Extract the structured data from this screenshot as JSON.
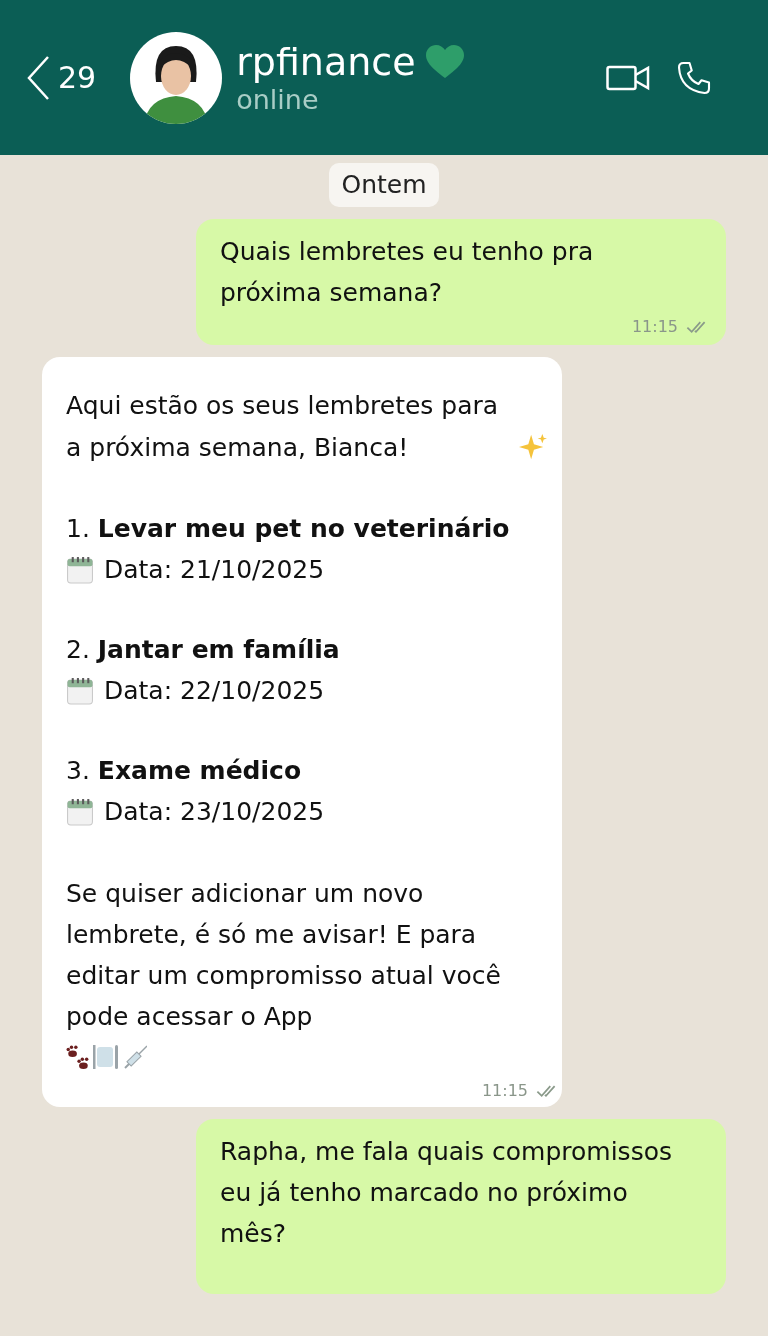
{
  "header": {
    "back_count": "29",
    "contact_name": "rpfinance",
    "status": "online"
  },
  "messages": [
    {
      "kind": "date",
      "label": "Ontem"
    },
    {
      "kind": "outgoing",
      "text": "Quais lembretes eu tenho pra próxima semana?",
      "time": "11:15"
    },
    {
      "kind": "incoming",
      "intro": "Aqui estão os seus lembretes para a próxima semana, Bianca!",
      "items": [
        {
          "title": "1. **Levar meu pet no veterinário**",
          "date": "Data: 21/10/2025"
        },
        {
          "title": "2. **Jantar em família**",
          "date": "Data: 22/10/2025"
        },
        {
          "title": "3. **Exame médico**",
          "date": "Data: 23/10/2025"
        }
      ],
      "closing": "Se quiser adicionar um novo lembrete, é só me avisar! E para editar um compromisso atual você pode acessar o App",
      "time": "11:15"
    },
    {
      "kind": "outgoing",
      "text": "Rapha, me fala quais compromissos eu já tenho marcado no próximo mês?"
    }
  ]
}
